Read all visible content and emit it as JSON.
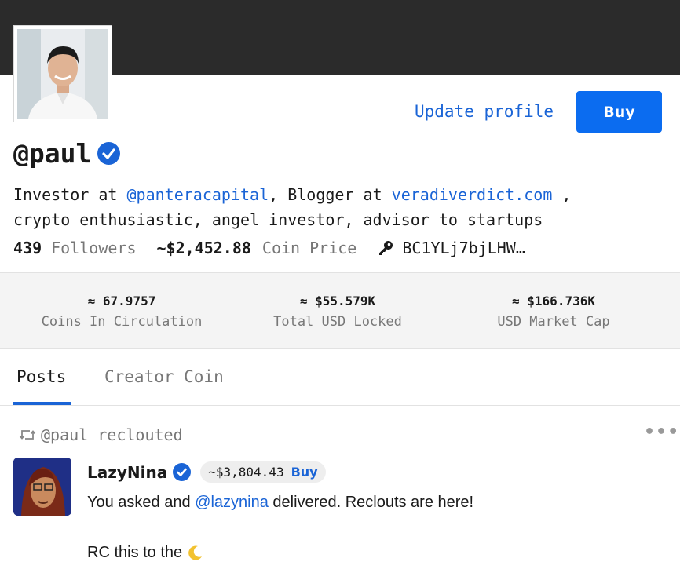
{
  "profile": {
    "update_label": "Update profile",
    "buy_label": "Buy",
    "username": "@paul",
    "bio": {
      "line1_prefix": "Investor at ",
      "line1_mention": "@panteracapital",
      "line1_mid": ", Blogger at ",
      "line1_link": "veradiverdict.com",
      "line1_suffix": " ,",
      "line2": "crypto enthusiastic, angel investor, advisor to startups"
    },
    "followers_count": "439",
    "followers_label": "Followers",
    "coin_price": "~$2,452.88",
    "coin_price_label": "Coin Price",
    "public_key": "BC1YLj7bjLHW…"
  },
  "coin_stats": [
    {
      "value": "≈ 67.9757",
      "label": "Coins In Circulation"
    },
    {
      "value": "≈ $55.579K",
      "label": "Total USD Locked"
    },
    {
      "value": "≈ $166.736K",
      "label": "USD Market Cap"
    }
  ],
  "tabs": [
    {
      "label": "Posts",
      "active": true
    },
    {
      "label": "Creator Coin",
      "active": false
    }
  ],
  "feed": {
    "reclout_text": "@paul reclouted",
    "more_label": "•••",
    "post": {
      "author": "LazyNina",
      "coin_price": "~$3,804.43",
      "buy_label": "Buy",
      "body_prefix": "You asked and ",
      "body_mention": "@lazynina",
      "body_suffix": " delivered. Reclouts are here!",
      "body_line2": "RC this to the"
    }
  },
  "colors": {
    "accent": "#1a64d6",
    "buy_button": "#0b6cf0",
    "banner": "#2b2b2b",
    "muted_text": "#777777"
  },
  "icons": [
    "verified-check-icon",
    "key-icon",
    "reclout-icon",
    "more-dots-icon",
    "moon-icon"
  ]
}
